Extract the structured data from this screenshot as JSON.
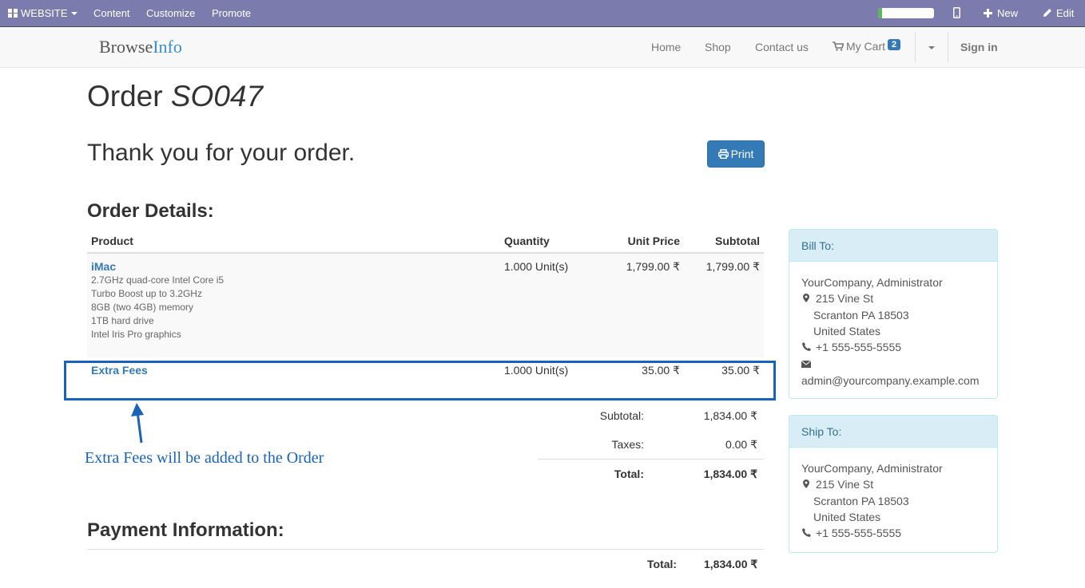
{
  "adminbar": {
    "website_label": "WEBSITE",
    "menu": [
      "Content",
      "Customize",
      "Promote"
    ],
    "progress_fraction": 0.07,
    "new_label": "New",
    "edit_label": "Edit"
  },
  "navbar": {
    "brand_main": "Browse",
    "brand_accent": "Info",
    "links": [
      "Home",
      "Shop",
      "Contact us"
    ],
    "cart_label": "My Cart",
    "cart_count": "2",
    "signin": "Sign in"
  },
  "page": {
    "title_prefix": "Order",
    "order_number": "SO047",
    "thank_you": "Thank you for your order.",
    "print_label": "Print",
    "order_details_heading": "Order Details:",
    "payment_heading": "Payment Information:"
  },
  "table": {
    "headers": [
      "Product",
      "Quantity",
      "Unit Price",
      "Subtotal"
    ],
    "rows": [
      {
        "product": "iMac",
        "description": [
          "2.7GHz quad-core Intel Core i5",
          "Turbo Boost up to 3.2GHz",
          "8GB (two 4GB) memory",
          "1TB hard drive",
          "Intel Iris Pro graphics"
        ],
        "quantity": "1.000 Unit(s)",
        "unit_price": "1,799.00 ₹",
        "subtotal": "1,799.00 ₹"
      },
      {
        "product": "Extra Fees",
        "quantity": "1.000 Unit(s)",
        "unit_price": "35.00 ₹",
        "subtotal": "35.00 ₹"
      }
    ]
  },
  "totals": {
    "subtotal_label": "Subtotal:",
    "subtotal": "1,834.00 ₹",
    "taxes_label": "Taxes:",
    "taxes": "0.00 ₹",
    "total_label": "Total:",
    "total": "1,834.00 ₹"
  },
  "annotation": "Extra Fees will be added to the Order",
  "payment": {
    "total_label": "Total:",
    "total": "1,834.00 ₹"
  },
  "bill_to": {
    "heading": "Bill To:",
    "name": "YourCompany, Administrator",
    "street": "215 Vine St",
    "city": "Scranton PA 18503",
    "country": "United States",
    "phone": "+1 555-555-5555",
    "email": "admin@yourcompany.example.com"
  },
  "ship_to": {
    "heading": "Ship To:",
    "name": "YourCompany, Administrator",
    "street": "215 Vine St",
    "city": "Scranton PA 18503",
    "country": "United States",
    "phone": "+1 555-555-5555"
  },
  "colors": {
    "admin_bar": "#7c7bad",
    "primary": "#337ab7",
    "annotation": "#1a63b8",
    "panel_heading": "#d9edf7"
  }
}
